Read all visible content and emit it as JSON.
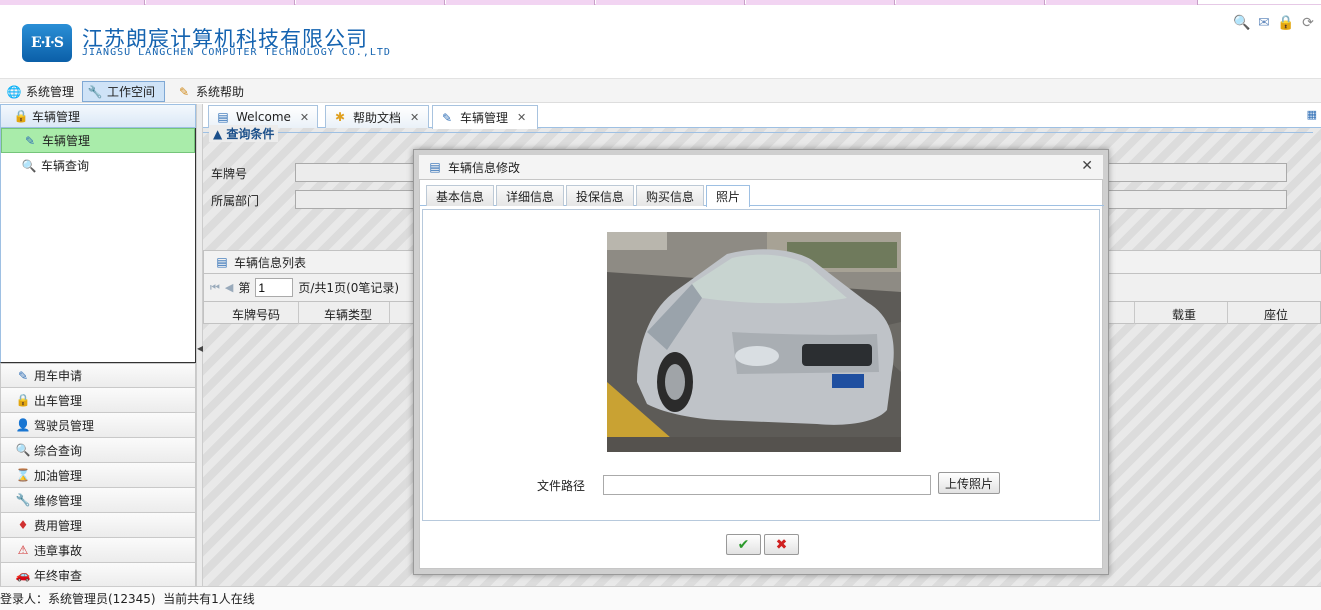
{
  "header": {
    "logo_text": "E·I·S",
    "company_cn": "江苏朗宸计算机科技有限公司",
    "company_en": "JIANGSU LANGCHEN COMPUTER TECHNOLOGY CO.,LTD",
    "icons": [
      "search-icon",
      "mail-icon",
      "lock-icon",
      "refresh-icon"
    ]
  },
  "menubar": {
    "items": [
      {
        "label": "系统管理",
        "icon": "globe-icon"
      },
      {
        "label": "工作空间",
        "icon": "wrench-icon",
        "active": true
      },
      {
        "label": "系统帮助",
        "icon": "help-icon"
      }
    ]
  },
  "sidebar": {
    "header": "车辆管理",
    "sub_items": [
      {
        "label": "车辆管理",
        "selected": true
      },
      {
        "label": "车辆查询"
      }
    ],
    "accordion": [
      {
        "label": "用车申请"
      },
      {
        "label": "出车管理"
      },
      {
        "label": "驾驶员管理"
      },
      {
        "label": "综合查询"
      },
      {
        "label": "加油管理"
      },
      {
        "label": "维修管理"
      },
      {
        "label": "费用管理"
      },
      {
        "label": "违章事故"
      },
      {
        "label": "年终审查"
      }
    ]
  },
  "tabs": [
    {
      "label": "Welcome"
    },
    {
      "label": "帮助文档"
    },
    {
      "label": "车辆管理",
      "active": true
    }
  ],
  "query": {
    "legend": "查询条件",
    "fields": [
      {
        "label": "车牌号"
      },
      {
        "label": "所属部门"
      }
    ]
  },
  "list": {
    "title": "车辆信息列表",
    "pager": {
      "prefix": "第",
      "page": "1",
      "suffix": "页/共1页(0笔记录)"
    },
    "columns": [
      "车牌号码",
      "车辆类型",
      "载重",
      "座位"
    ]
  },
  "dialog": {
    "title": "车辆信息修改",
    "tabs": [
      "基本信息",
      "详细信息",
      "投保信息",
      "购买信息",
      "照片"
    ],
    "active_tab": "照片",
    "path_label": "文件路径",
    "path_value": "",
    "upload_label": "上传照片",
    "ok_symbol": "✔",
    "cancel_symbol": "✖"
  },
  "status": {
    "text": "登录人：系统管理员(12345)  当前共有1人在线"
  },
  "colors": {
    "brand": "#1463b0",
    "selected_green": "#a9ecaa",
    "tab_border": "#9ec0e3"
  }
}
